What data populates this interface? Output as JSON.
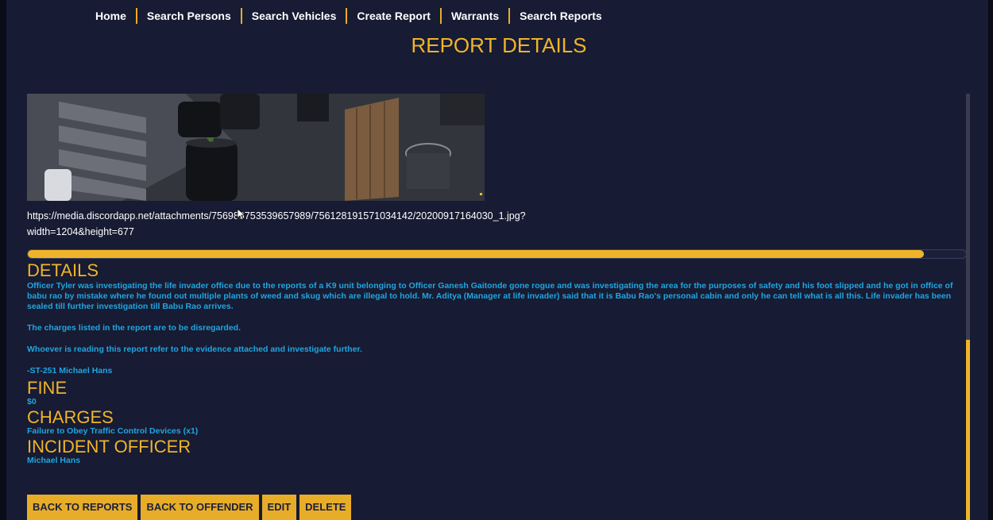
{
  "nav": {
    "items": [
      "Home",
      "Search Persons",
      "Search Vehicles",
      "Create Report",
      "Warrants",
      "Search Reports"
    ]
  },
  "page": {
    "title": "REPORT DETAILS"
  },
  "evidence": {
    "url_line1": "https://media.discordapp.net/attachments/756989753539657989/756128191571034142/20200917164030_1.jpg?",
    "url_line2": "width=1204&height=677"
  },
  "progress": {
    "fraction": 0.955
  },
  "details": {
    "heading": "DETAILS",
    "paragraphs": [
      "Officer Tyler was investigating the life invader office due to the reports of a K9 unit belonging to Officer Ganesh Gaitonde gone rogue and was investigating the area for the purposes of safety and his foot slipped and he got in office of babu rao by mistake where he found out multiple plants of weed and skug which are illegal to hold. Mr. Aditya (Manager at life invader) said that it is Babu Rao's personal cabin and only he can tell what is all this. Life invader has been sealed till further investigation till Babu Rao arrives.",
      "The charges listed in the report are to be disregarded.",
      "Whoever is reading this report refer to the evidence attached and investigate further.",
      "-ST-251 Michael Hans"
    ]
  },
  "fine": {
    "heading": "FINE",
    "value": "$0"
  },
  "charges": {
    "heading": "CHARGES",
    "value": "Failure to Obey Traffic Control Devices (x1)"
  },
  "incident_officer": {
    "heading": "INCIDENT OFFICER",
    "value": "Michael Hans"
  },
  "actions": {
    "back_to_reports": "BACK TO REPORTS",
    "back_to_offender": "BACK TO OFFENDER",
    "edit": "EDIT",
    "delete": "DELETE"
  },
  "colors": {
    "background": "#171b33",
    "accent": "#f0b429",
    "text_blue": "#1fa6e0",
    "button_bg": "#e8ad28"
  }
}
